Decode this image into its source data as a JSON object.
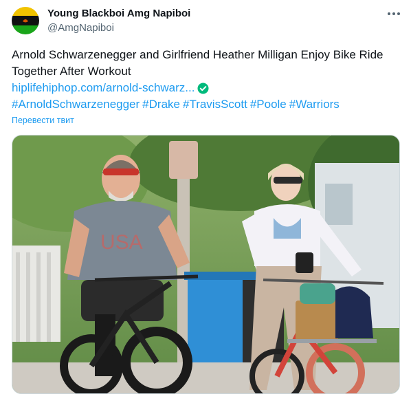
{
  "author": {
    "display_name": "Young Blackboi Amg Napiboi",
    "handle": "@AmgNapiboi",
    "avatar_icon": "flag-avatar"
  },
  "more_icon": "more-horizontal-icon",
  "tweet": {
    "text_lines": [
      "Arnold Schwarzenegger and Girlfriend Heather Milligan Enjoy Bike Ride",
      "Together After Workout"
    ],
    "link_text": "hiplifehiphop.com/arnold-schwarz...",
    "link_badge_icon": "verified-check-icon",
    "hashtags": [
      "#ArnoldSchwarzenegger",
      "#Drake",
      "#TravisScott",
      "#Poole",
      "#Warriors"
    ],
    "translate_label": "Перевести твит"
  },
  "photo": {
    "subject": "two-people-riding-bikes"
  },
  "colors": {
    "link": "#1d9bf0",
    "text": "#0f1419",
    "secondary": "#536471",
    "border": "#cfd9de",
    "verified": "#00ba7c"
  }
}
